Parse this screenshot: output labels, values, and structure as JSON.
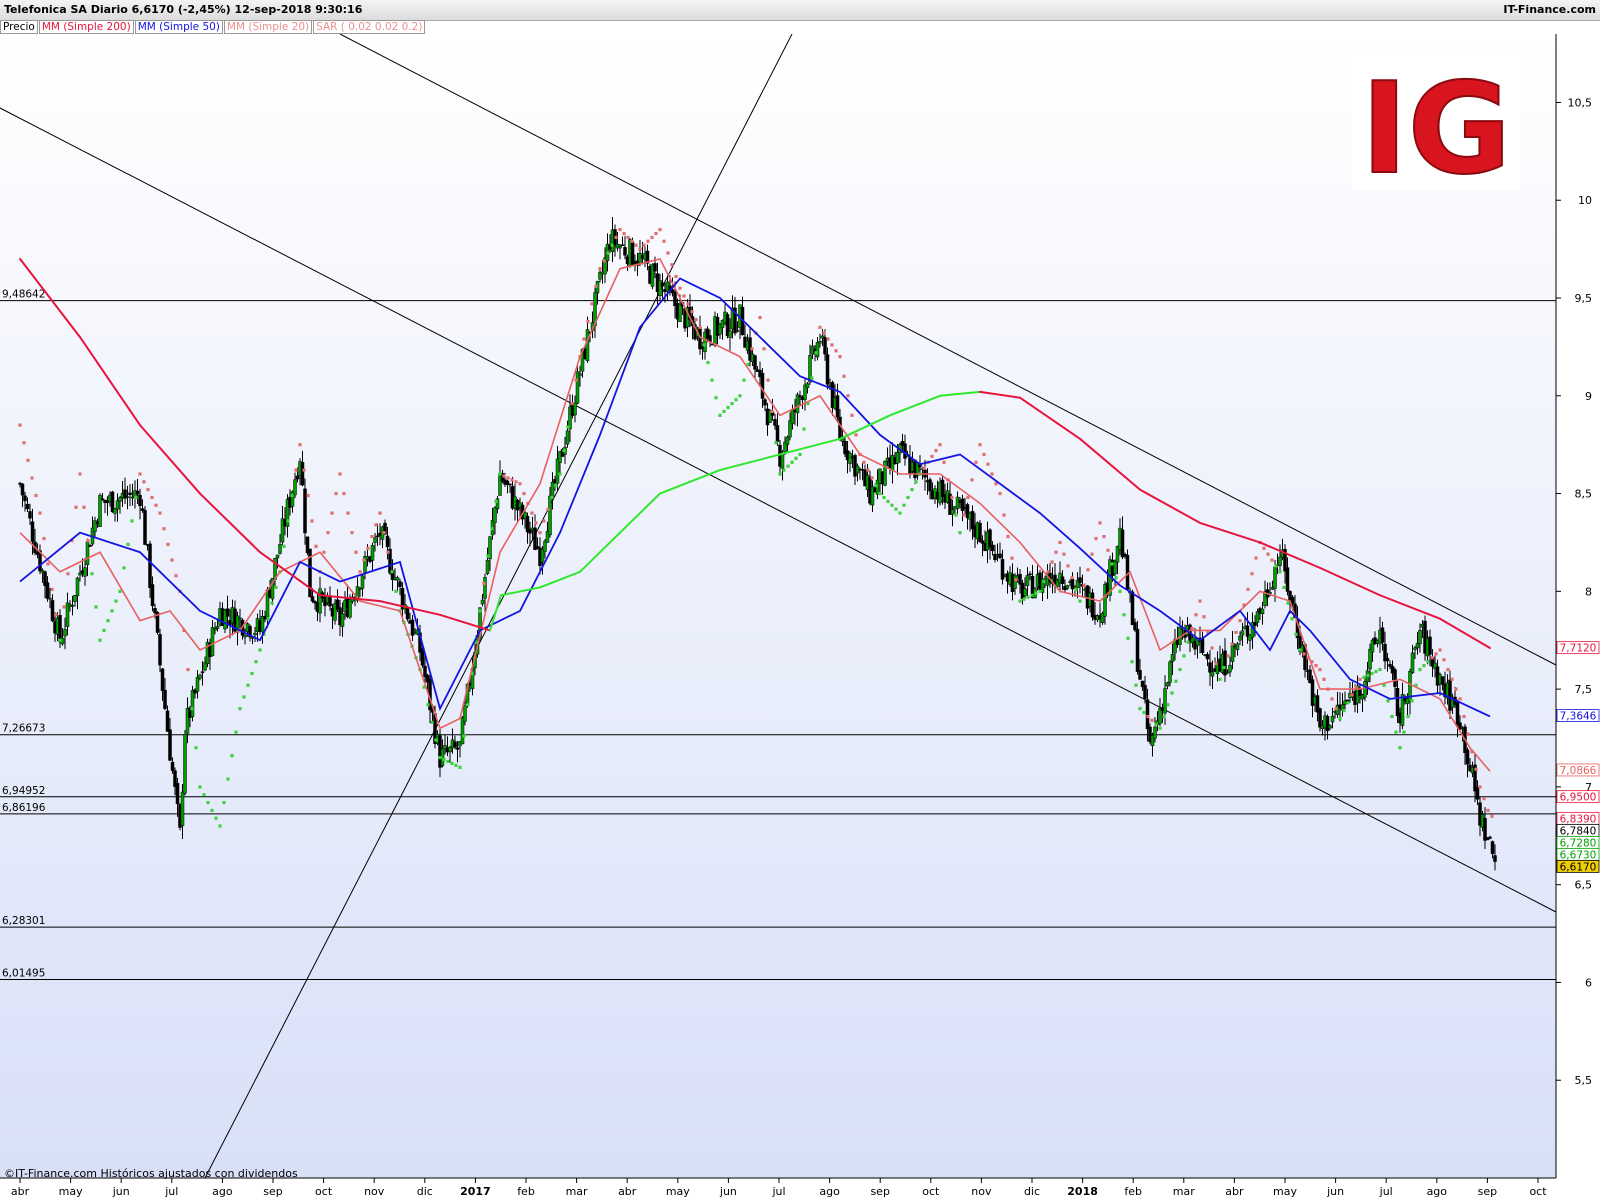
{
  "header": {
    "title": "Telefonica SA   Diario   6,6170 (-2,45%)   12-sep-2018 9:30:16",
    "brand": "IT-Finance.com"
  },
  "legend": {
    "price": "Precio",
    "sma200": "MM (Simple 200)",
    "sma50": "MM (Simple 50)",
    "sma20": "MM (Simple 20)",
    "sar": "SAR ( 0.02 0.02 0.2)"
  },
  "footer": {
    "note": "©IT-Finance.com  Históricos ajustados con dividendos"
  },
  "logo": {
    "text": "IG"
  },
  "colors": {
    "sma200": "#e8143c",
    "sma50": "#1414e0",
    "sma20": "#e86060",
    "sar_above": "#e07070",
    "sar_below": "#40d040",
    "candle_up": "#00a000",
    "candle_down": "#000000",
    "trendline": "#000000",
    "sma200_rising": "#2ee82e",
    "logo": "#d8141e",
    "last_price_bg": "#f0d000"
  },
  "chart_data": {
    "type": "line",
    "title": "Telefonica SA Diario",
    "ylim": [
      5.0,
      10.85
    ],
    "y_ticks": [
      "10,5",
      "10",
      "9,5",
      "9",
      "8,5",
      "8",
      "7,5",
      "7",
      "6,5",
      "6",
      "5,5"
    ],
    "x_ticks": [
      "abr",
      "may",
      "jun",
      "jul",
      "ago",
      "sep",
      "oct",
      "nov",
      "dic",
      "2017",
      "feb",
      "mar",
      "abr",
      "may",
      "jun",
      "jul",
      "ago",
      "sep",
      "oct",
      "nov",
      "dic",
      "2018",
      "feb",
      "mar",
      "abr",
      "may",
      "jun",
      "jul",
      "ago",
      "sep",
      "oct"
    ],
    "horizontal_levels": [
      {
        "label": "9,48642",
        "value": 9.48642
      },
      {
        "label": "7,26673",
        "value": 7.26673
      },
      {
        "label": "6,94952",
        "value": 6.94952
      },
      {
        "label": "6,86196",
        "value": 6.86196
      },
      {
        "label": "6,28301",
        "value": 6.28301
      },
      {
        "label": "6,01495",
        "value": 6.01495
      }
    ],
    "price_tags": [
      {
        "label": "7,7120",
        "value": 7.712,
        "color": "#e8143c",
        "bg": "#ffffff"
      },
      {
        "label": "7,3646",
        "value": 7.3646,
        "color": "#1414e0",
        "bg": "#ffffff"
      },
      {
        "label": "7,0866",
        "value": 7.0866,
        "color": "#e86060",
        "bg": "#ffffff"
      },
      {
        "label": "6,9500",
        "value": 6.95,
        "color": "#e8143c",
        "bg": "#ffffff"
      },
      {
        "label": "6,8390",
        "value": 6.839,
        "color": "#e8143c",
        "bg": "#ffffff"
      },
      {
        "label": "6,7840",
        "value": 6.784,
        "color": "#000000",
        "bg": "#ffffff"
      },
      {
        "label": "6,7280",
        "value": 6.728,
        "color": "#00a000",
        "bg": "#ffffff"
      },
      {
        "label": "6,6730",
        "value": 6.673,
        "color": "#00a000",
        "bg": "#ffffff"
      },
      {
        "label": "6,6170",
        "value": 6.617,
        "color": "#000000",
        "bg": "#f0d000"
      }
    ],
    "series": [
      {
        "name": "Precio",
        "x": [
          0,
          40,
          80,
          120,
          160,
          165,
          200,
          240,
          280,
          290,
          320,
          360,
          400,
          420,
          440,
          480,
          520,
          550,
          590,
          620,
          650,
          680,
          700,
          720,
          760,
          800,
          820,
          850,
          880,
          920,
          960,
          1000,
          1040,
          1080,
          1100,
          1130,
          1160,
          1200,
          1240,
          1260,
          1300,
          1340,
          1360,
          1380,
          1400,
          1420,
          1440,
          1460,
          1475
        ],
        "values": [
          8.55,
          7.75,
          8.45,
          8.5,
          6.75,
          7.3,
          7.9,
          7.8,
          8.7,
          8.0,
          7.85,
          8.3,
          7.7,
          7.15,
          7.2,
          8.6,
          8.2,
          8.9,
          9.8,
          9.7,
          9.5,
          9.3,
          9.35,
          9.4,
          8.7,
          9.3,
          8.8,
          8.5,
          8.7,
          8.5,
          8.3,
          8.0,
          8.1,
          7.9,
          8.3,
          7.2,
          7.8,
          7.6,
          7.9,
          8.2,
          7.3,
          7.5,
          7.8,
          7.35,
          7.8,
          7.55,
          7.35,
          6.85,
          6.62
        ]
      },
      {
        "name": "MM (Simple 200)",
        "x": [
          0,
          60,
          120,
          180,
          240,
          300,
          360,
          420,
          470,
          481,
          520,
          560,
          600,
          640,
          700,
          760,
          820,
          870,
          920,
          960,
          1000,
          1060,
          1120,
          1180,
          1240,
          1300,
          1360,
          1420,
          1470
        ],
        "values": [
          9.7,
          9.3,
          8.85,
          8.5,
          8.2,
          7.98,
          7.95,
          7.88,
          7.8,
          7.98,
          8.02,
          8.1,
          8.3,
          8.5,
          8.62,
          8.7,
          8.78,
          8.9,
          9.0,
          9.02,
          8.99,
          8.78,
          8.52,
          8.35,
          8.25,
          8.12,
          7.98,
          7.86,
          7.71
        ]
      },
      {
        "name": "MM (Simple 50)",
        "x": [
          0,
          60,
          120,
          180,
          240,
          280,
          320,
          380,
          420,
          460,
          500,
          540,
          580,
          620,
          660,
          700,
          740,
          780,
          820,
          860,
          900,
          940,
          980,
          1020,
          1060,
          1100,
          1140,
          1180,
          1220,
          1250,
          1270,
          1290,
          1330,
          1370,
          1420,
          1470
        ],
        "values": [
          8.05,
          8.3,
          8.2,
          7.9,
          7.75,
          8.15,
          8.05,
          8.15,
          7.4,
          7.8,
          7.9,
          8.3,
          8.8,
          9.35,
          9.6,
          9.5,
          9.3,
          9.1,
          9.02,
          8.8,
          8.65,
          8.7,
          8.55,
          8.4,
          8.22,
          8.03,
          7.9,
          7.75,
          7.9,
          7.7,
          7.9,
          7.8,
          7.55,
          7.45,
          7.48,
          7.36
        ]
      },
      {
        "name": "MM (Simple 20)",
        "x": [
          0,
          40,
          80,
          120,
          150,
          180,
          220,
          260,
          300,
          340,
          380,
          420,
          440,
          480,
          520,
          560,
          600,
          640,
          680,
          720,
          760,
          800,
          840,
          880,
          920,
          960,
          1000,
          1040,
          1080,
          1110,
          1140,
          1170,
          1200,
          1240,
          1270,
          1300,
          1340,
          1380,
          1420,
          1450,
          1470
        ],
        "values": [
          8.3,
          8.1,
          8.2,
          7.85,
          7.9,
          7.7,
          7.8,
          8.1,
          8.2,
          7.95,
          7.9,
          7.3,
          7.35,
          8.2,
          8.55,
          9.2,
          9.65,
          9.7,
          9.3,
          9.2,
          8.9,
          9.0,
          8.7,
          8.6,
          8.6,
          8.45,
          8.25,
          8.0,
          7.95,
          8.1,
          7.7,
          7.8,
          7.8,
          8.0,
          7.95,
          7.5,
          7.5,
          7.55,
          7.45,
          7.2,
          7.08
        ]
      },
      {
        "name": "SAR ( 0.02 0.02 0.2)",
        "x": [
          0,
          20,
          40,
          60,
          80,
          100,
          120,
          140,
          160,
          180,
          200,
          220,
          240,
          260,
          280,
          300,
          320,
          340,
          360,
          380,
          400,
          420,
          440,
          460,
          480,
          500,
          520,
          540,
          560,
          580,
          600,
          620,
          640,
          660,
          680,
          700,
          720,
          740,
          760,
          780,
          800,
          820,
          840,
          860,
          880,
          900,
          920,
          940,
          960,
          980,
          1000,
          1020,
          1040,
          1060,
          1080,
          1100,
          1120,
          1140,
          1160,
          1180,
          1200,
          1220,
          1240,
          1260,
          1280,
          1300,
          1320,
          1340,
          1360,
          1380,
          1400,
          1420,
          1440,
          1460,
          1470
        ],
        "values": [
          8.85,
          8.4,
          7.75,
          8.6,
          7.75,
          8.0,
          8.6,
          8.4,
          8.0,
          7.0,
          6.8,
          7.4,
          7.7,
          8.1,
          8.75,
          8.1,
          8.6,
          8.1,
          8.4,
          7.9,
          7.6,
          7.15,
          7.1,
          7.9,
          8.6,
          8.55,
          8.3,
          8.6,
          9.2,
          9.65,
          9.85,
          9.75,
          9.85,
          9.55,
          9.35,
          8.9,
          9.0,
          9.4,
          8.6,
          8.7,
          9.35,
          9.2,
          8.7,
          8.5,
          8.4,
          8.6,
          8.75,
          8.3,
          8.75,
          8.5,
          7.95,
          8.0,
          8.25,
          7.95,
          8.35,
          8.0,
          7.4,
          7.3,
          7.6,
          7.95,
          7.55,
          7.85,
          8.25,
          8.1,
          7.7,
          7.6,
          7.35,
          7.55,
          7.6,
          7.2,
          7.6,
          7.7,
          7.45,
          7.0,
          6.85
        ]
      }
    ]
  }
}
